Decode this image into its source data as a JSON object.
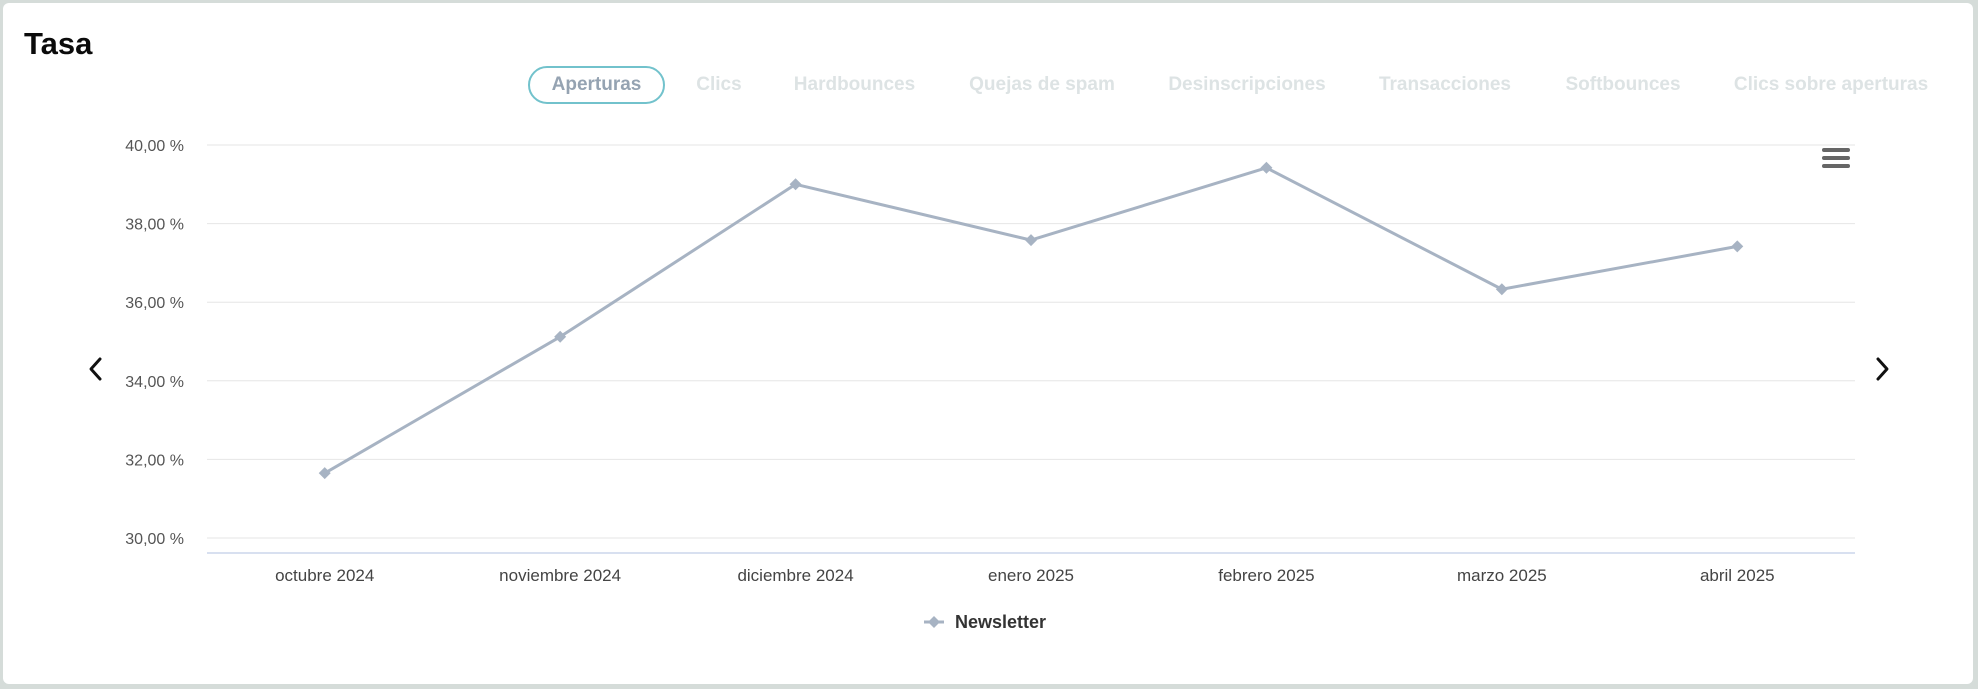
{
  "title": "Tasa",
  "tabs": [
    {
      "label": "Aperturas",
      "active": true
    },
    {
      "label": "Clics",
      "active": false
    },
    {
      "label": "Hardbounces",
      "active": false
    },
    {
      "label": "Quejas de spam",
      "active": false
    },
    {
      "label": "Desinscripciones",
      "active": false
    },
    {
      "label": "Transacciones",
      "active": false
    },
    {
      "label": "Softbounces",
      "active": false
    },
    {
      "label": "Clics sobre aperturas",
      "active": false
    }
  ],
  "icons": {
    "menu": "hamburger-menu-icon",
    "prev": "chevron-left-icon",
    "next": "chevron-right-icon"
  },
  "colors": {
    "series": "#a7b3c3",
    "active_tab_border": "#72c2cc",
    "inactive_tab": "#dde3e4"
  },
  "chart_data": {
    "type": "line",
    "categories": [
      "octubre 2024",
      "noviembre 2024",
      "diciembre 2024",
      "enero 2025",
      "febrero 2025",
      "marzo 2025",
      "abril 2025"
    ],
    "series": [
      {
        "name": "Newsletter",
        "values": [
          31.65,
          35.12,
          39.0,
          37.58,
          39.42,
          36.33,
          37.42
        ]
      }
    ],
    "y_ticks": [
      "30,00 %",
      "32,00 %",
      "34,00 %",
      "36,00 %",
      "38,00 %",
      "40,00 %"
    ],
    "ylim": [
      30,
      40
    ],
    "grid": true,
    "legend_position": "bottom-center",
    "xlabel": "",
    "ylabel": ""
  }
}
